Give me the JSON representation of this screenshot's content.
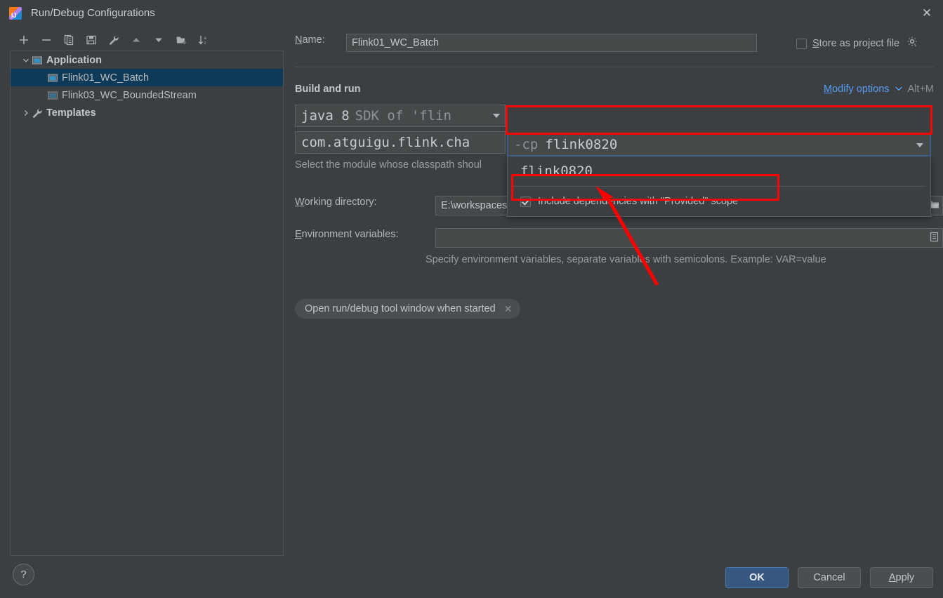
{
  "window": {
    "title": "Run/Debug Configurations",
    "close_label": "✕",
    "app_icon": "intellij-idea-icon"
  },
  "toolbar": {
    "buttons": [
      {
        "name": "add-configuration-button",
        "icon": "plus-icon",
        "label": "+"
      },
      {
        "name": "remove-configuration-button",
        "icon": "minus-icon",
        "label": "−"
      },
      {
        "name": "copy-configuration-button",
        "icon": "copy-icon",
        "label": "copy"
      },
      {
        "name": "save-configuration-button",
        "icon": "save-icon",
        "label": "save"
      },
      {
        "name": "edit-templates-button",
        "icon": "wrench-icon",
        "label": "wrench"
      },
      {
        "name": "move-up-button",
        "icon": "triangle-up-icon",
        "label": "up"
      },
      {
        "name": "move-down-button",
        "icon": "triangle-down-icon",
        "label": "down"
      },
      {
        "name": "new-folder-button",
        "icon": "folder-add-icon",
        "label": "new folder"
      },
      {
        "name": "sort-alphabetically-button",
        "icon": "sort-az-icon",
        "label": "sort"
      }
    ]
  },
  "tree": {
    "nodes": [
      {
        "label": "Application",
        "level": 1,
        "expanded": true,
        "selected": false,
        "bold": true,
        "icon": "application-icon"
      },
      {
        "label": "Flink01_WC_Batch",
        "level": 2,
        "expanded": null,
        "selected": true,
        "bold": false,
        "icon": "application-icon"
      },
      {
        "label": "Flink03_WC_BoundedStream",
        "level": 2,
        "expanded": null,
        "selected": false,
        "bold": false,
        "icon": "application-icon"
      },
      {
        "label": "Templates",
        "level": 1,
        "expanded": false,
        "selected": false,
        "bold": true,
        "icon": "wrench-icon"
      }
    ]
  },
  "form": {
    "name_label": "Name:",
    "name_label_mnemonic": "N",
    "name_value": "Flink01_WC_Batch",
    "store_as_project_file_label": "Store as project file",
    "store_as_project_file_mnemonic": "S",
    "store_as_project_file_checked": false,
    "gear_icon": "gear-dropdown-icon",
    "build_and_run_label": "Build and run",
    "modify_options_label": "Modify options",
    "modify_options_mnemonic": "M",
    "modify_options_shortcut": "Alt+M",
    "jdk_value_primary": "java 8",
    "jdk_value_secondary": "SDK of 'flin",
    "main_class_value": "com.atguigu.flink.cha",
    "classpath_hint": "Select the module whose classpath shoul",
    "working_directory_label": "Working directory:",
    "working_directory_mnemonic": "W",
    "working_directory_value": "E:\\workspaces\\flink0820",
    "environment_variables_label": "Environment variables:",
    "environment_variables_mnemonic": "E",
    "environment_variables_value": "",
    "environment_variables_hint": "Specify environment variables, separate variables with semicolons. Example: VAR=value",
    "macro_icon": "macro-list-icon",
    "browse_icon": "folder-browse-icon",
    "chip_label": "Open run/debug tool window when started",
    "chip_close_icon": "close-small-icon"
  },
  "classpath_dropdown": {
    "prefix": "-cp",
    "selected_value": "flink0820",
    "expanded": true,
    "arrow_icon": "chevron-down-icon",
    "options": [
      "flink0820"
    ],
    "include_provided_label": "Include dependencies with \"Provided\" scope",
    "include_provided_checked": true
  },
  "annotations": {
    "highlight_color": "#ff0000",
    "boxes": [
      {
        "name": "classpath-combo-highlight"
      },
      {
        "name": "include-provided-highlight"
      }
    ],
    "arrow": {
      "name": "pointer-arrow",
      "points_to": "include-provided-checkbox"
    }
  },
  "footer": {
    "help_label": "?",
    "ok_label": "OK",
    "cancel_label": "Cancel",
    "apply_label": "Apply",
    "apply_mnemonic": "A",
    "ok_color": "#365880"
  }
}
